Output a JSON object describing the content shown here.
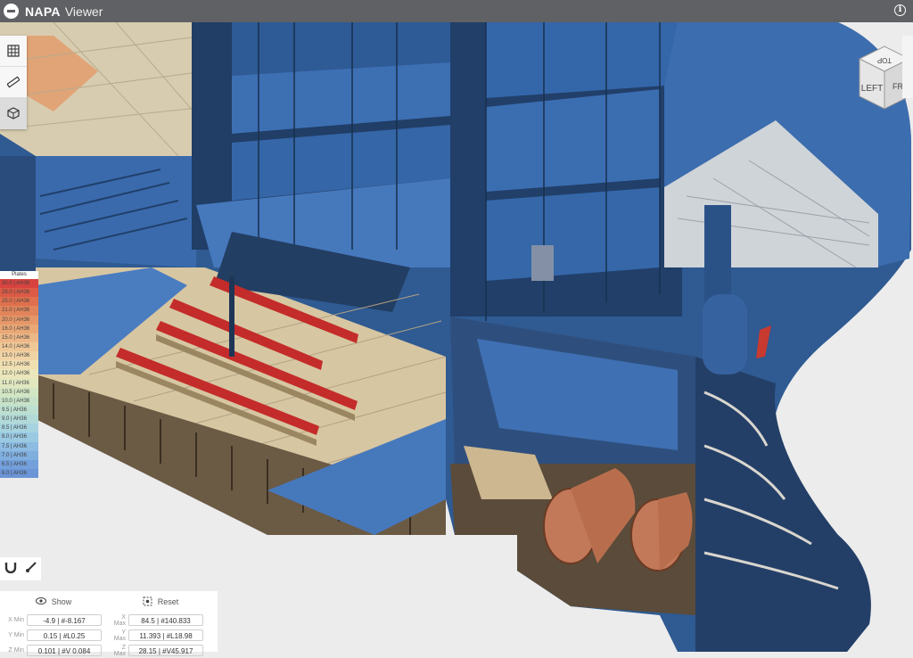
{
  "app": {
    "brand": "NAPA",
    "product": "Viewer",
    "info_icon": "info-icon"
  },
  "toolbar": {
    "tools": [
      {
        "icon": "grid-table-icon",
        "glyph": "▦"
      },
      {
        "icon": "ruler-measure-icon",
        "glyph": "📏"
      },
      {
        "icon": "3d-cube-icon",
        "glyph": "⬡"
      }
    ]
  },
  "legend": {
    "title": "Plates",
    "rows": [
      {
        "label": "30.0 | AH36",
        "color": "#d8433f"
      },
      {
        "label": "28.0 | AH36",
        "color": "#dc5a46"
      },
      {
        "label": "25.0 | AH36",
        "color": "#e0704d"
      },
      {
        "label": "21.0 | AH36",
        "color": "#e2845a"
      },
      {
        "label": "20.0 | AH36",
        "color": "#e69768"
      },
      {
        "label": "16.0 | AH36",
        "color": "#eaa877"
      },
      {
        "label": "15.0 | AH36",
        "color": "#edb887"
      },
      {
        "label": "14.0 | AH36",
        "color": "#f0c897"
      },
      {
        "label": "13.0 | AH36",
        "color": "#f1d4a5"
      },
      {
        "label": "12.5 | AH36",
        "color": "#f0dfb1"
      },
      {
        "label": "12.0 | AH36",
        "color": "#ebe6bb"
      },
      {
        "label": "11.0 | AH36",
        "color": "#e1e8c0"
      },
      {
        "label": "10.5 | AH36",
        "color": "#d3e6c4"
      },
      {
        "label": "10.0 | AH36",
        "color": "#c7e2c8"
      },
      {
        "label": "9.5 | AH36",
        "color": "#bcdfd0"
      },
      {
        "label": "9.0 | AH36",
        "color": "#b1dad8"
      },
      {
        "label": "8.5 | AH36",
        "color": "#a6d3df"
      },
      {
        "label": "8.0 | AH36",
        "color": "#9ac9e2"
      },
      {
        "label": "7.5 | AH36",
        "color": "#8cbce2"
      },
      {
        "label": "7.0 | AH36",
        "color": "#7faedf"
      },
      {
        "label": "6.5 | AH36",
        "color": "#73a0db"
      },
      {
        "label": "6.0 | AH36",
        "color": "#6b95d6"
      }
    ]
  },
  "mini_tools": [
    {
      "icon": "magnet-icon",
      "glyph": "⋃"
    },
    {
      "icon": "brush-icon",
      "glyph": "⁄"
    }
  ],
  "range": {
    "show_label": "Show",
    "reset_label": "Reset",
    "show_icon": "eye-icon",
    "reset_icon": "reset-target-icon",
    "x_min_label": "X Min",
    "x_min": "-4.9 | #-8.167",
    "x_max_label": "X Max",
    "x_max": "84.5 | #140.833",
    "y_min_label": "Y Min",
    "y_min": "0.15 | #L0.25",
    "y_max_label": "Y Max",
    "y_max": "11.393 | #L18.98",
    "z_min_label": "Z Min",
    "z_min": "0.101 | #V 0.084",
    "z_max_label": "Z Max",
    "z_max": "28.15 | #V45.917"
  },
  "nav_cube": {
    "left": "LEFT",
    "front": "FR",
    "top": "TOP"
  },
  "colors": {
    "hull_blue": "#33609e",
    "dark_blue": "#1f3b63",
    "deck_tan": "#d6c7a6",
    "bar_red": "#c8302c",
    "pipe_copper": "#c8835e"
  }
}
